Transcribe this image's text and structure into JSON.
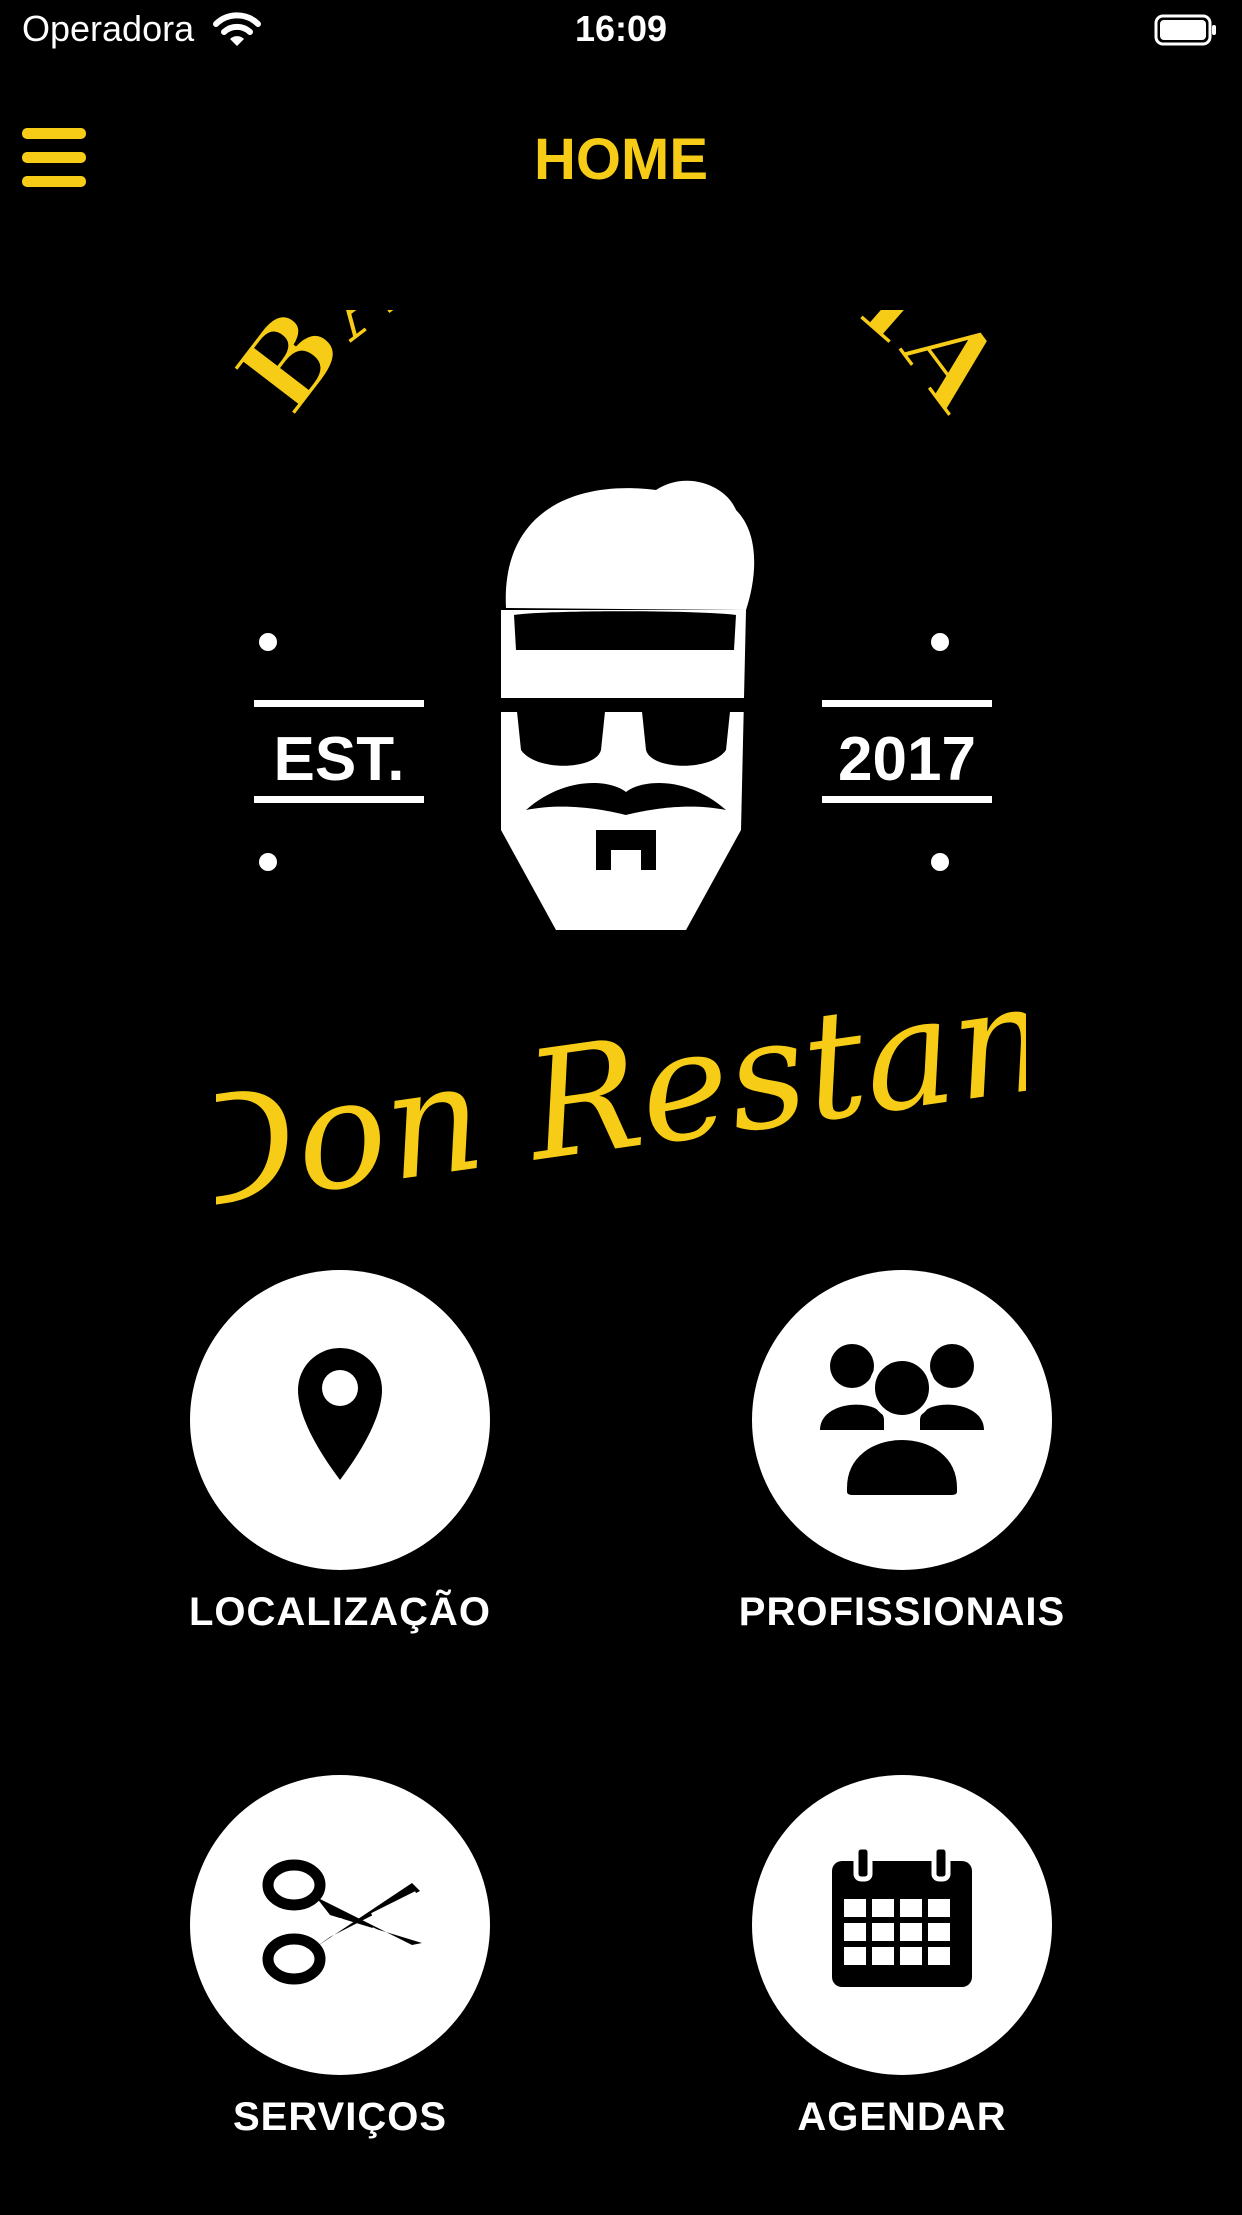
{
  "status_bar": {
    "carrier": "Operadora",
    "time": "16:09",
    "wifi_icon": "wifi-icon",
    "battery_icon": "battery-icon"
  },
  "nav": {
    "title": "HOME",
    "menu_icon": "hamburger-menu-icon"
  },
  "logo": {
    "top_text": "BARBEARIA",
    "left_badge": "EST.",
    "right_badge": "2017",
    "script_text": "Don Restani"
  },
  "actions": [
    {
      "label": "LOCALIZAÇÃO",
      "icon": "map-pin-icon"
    },
    {
      "label": "PROFISSIONAIS",
      "icon": "users-group-icon"
    },
    {
      "label": "SERVIÇOS",
      "icon": "scissors-icon"
    },
    {
      "label": "AGENDAR",
      "icon": "calendar-icon"
    }
  ],
  "colors": {
    "accent": "#f6cc17",
    "background": "#000000",
    "text": "#ffffff"
  }
}
